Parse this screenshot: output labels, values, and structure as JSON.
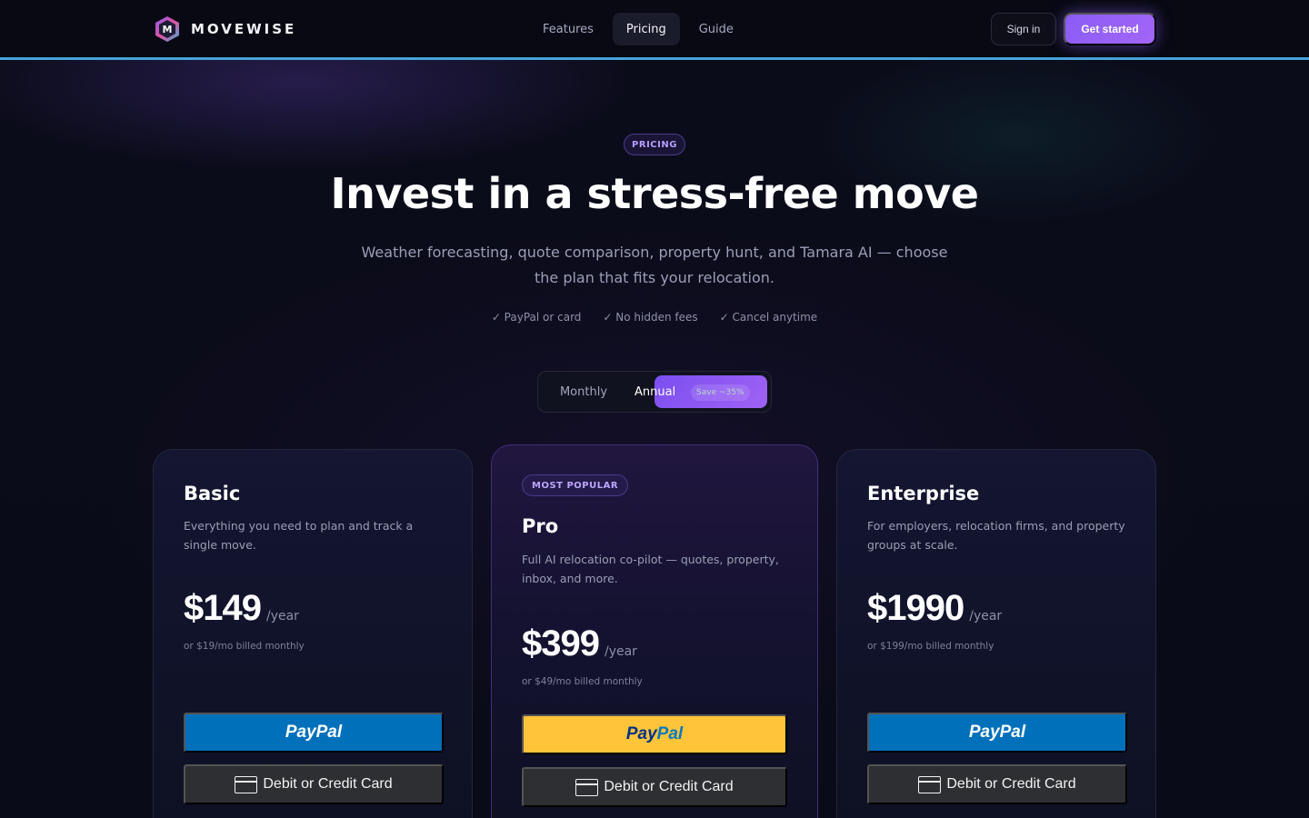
{
  "brand": {
    "logo_letter": "M",
    "name": "MOVEWISE"
  },
  "nav": {
    "links": [
      {
        "label": "Features",
        "active": false
      },
      {
        "label": "Pricing",
        "active": true
      },
      {
        "label": "Guide",
        "active": false
      }
    ],
    "signin_label": "Sign in",
    "cta_label": "Get started"
  },
  "hero": {
    "badge": "PRICING",
    "title": "Invest in a stress-free move",
    "subtitle": "Weather forecasting, quote comparison, property hunt, and Tamara AI — choose the plan that fits your relocation.",
    "checks": [
      "✓ PayPal or card",
      "✓ No hidden fees",
      "✓ Cancel anytime"
    ]
  },
  "billing_toggle": {
    "monthly_label": "Monthly",
    "annual_label": "Annual",
    "save_label": "Save ~35%",
    "selected": "Annual"
  },
  "plans": [
    {
      "name": "Basic",
      "description": "Everything you need to plan and track a single move.",
      "price": "$149",
      "period": "/year",
      "note": "or $19/mo billed monthly",
      "paypal_label": "PayPal",
      "card_label": "Debit or Credit Card",
      "badge": ""
    },
    {
      "name": "Pro",
      "description": "Full AI relocation co-pilot — quotes, property, inbox, and more.",
      "price": "$399",
      "period": "/year",
      "note": "or $49/mo billed monthly",
      "paypal_label_1": "Pay",
      "paypal_label_2": "Pal",
      "card_label": "Debit or Credit Card",
      "badge": "MOST POPULAR"
    },
    {
      "name": "Enterprise",
      "description": "For employers, relocation firms, and property groups at scale.",
      "price": "$1990",
      "period": "/year",
      "note": "or $199/mo billed monthly",
      "paypal_label": "PayPal",
      "card_label": "Debit or Credit Card",
      "badge": ""
    }
  ],
  "colors": {
    "accent": "#8b5cf6",
    "paypal_blue": "#0070ba",
    "paypal_gold": "#ffc439",
    "nav_underline": "#47a3d8"
  }
}
